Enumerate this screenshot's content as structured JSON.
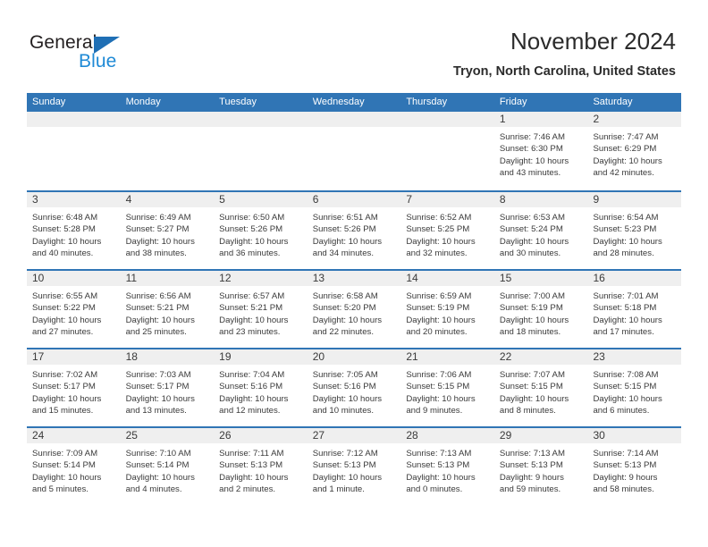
{
  "brand": {
    "name_top": "General",
    "name_bottom": "Blue",
    "triangle_color": "#1f6fb5",
    "blue_text_color": "#1f8ad6"
  },
  "header": {
    "title": "November 2024",
    "subtitle": "Tryon, North Carolina, United States",
    "accent_color": "#3075b5",
    "daynum_band_color": "#efefef"
  },
  "weekdays": [
    "Sunday",
    "Monday",
    "Tuesday",
    "Wednesday",
    "Thursday",
    "Friday",
    "Saturday"
  ],
  "labels": {
    "sunrise": "Sunrise:",
    "sunset": "Sunset:",
    "daylight": "Daylight:"
  },
  "weeks": [
    [
      {
        "day": "",
        "empty": true
      },
      {
        "day": "",
        "empty": true
      },
      {
        "day": "",
        "empty": true
      },
      {
        "day": "",
        "empty": true
      },
      {
        "day": "",
        "empty": true
      },
      {
        "day": "1",
        "sunrise": "Sunrise: 7:46 AM",
        "sunset": "Sunset: 6:30 PM",
        "daylight_1": "Daylight: 10 hours",
        "daylight_2": "and 43 minutes."
      },
      {
        "day": "2",
        "sunrise": "Sunrise: 7:47 AM",
        "sunset": "Sunset: 6:29 PM",
        "daylight_1": "Daylight: 10 hours",
        "daylight_2": "and 42 minutes."
      }
    ],
    [
      {
        "day": "3",
        "sunrise": "Sunrise: 6:48 AM",
        "sunset": "Sunset: 5:28 PM",
        "daylight_1": "Daylight: 10 hours",
        "daylight_2": "and 40 minutes."
      },
      {
        "day": "4",
        "sunrise": "Sunrise: 6:49 AM",
        "sunset": "Sunset: 5:27 PM",
        "daylight_1": "Daylight: 10 hours",
        "daylight_2": "and 38 minutes."
      },
      {
        "day": "5",
        "sunrise": "Sunrise: 6:50 AM",
        "sunset": "Sunset: 5:26 PM",
        "daylight_1": "Daylight: 10 hours",
        "daylight_2": "and 36 minutes."
      },
      {
        "day": "6",
        "sunrise": "Sunrise: 6:51 AM",
        "sunset": "Sunset: 5:26 PM",
        "daylight_1": "Daylight: 10 hours",
        "daylight_2": "and 34 minutes."
      },
      {
        "day": "7",
        "sunrise": "Sunrise: 6:52 AM",
        "sunset": "Sunset: 5:25 PM",
        "daylight_1": "Daylight: 10 hours",
        "daylight_2": "and 32 minutes."
      },
      {
        "day": "8",
        "sunrise": "Sunrise: 6:53 AM",
        "sunset": "Sunset: 5:24 PM",
        "daylight_1": "Daylight: 10 hours",
        "daylight_2": "and 30 minutes."
      },
      {
        "day": "9",
        "sunrise": "Sunrise: 6:54 AM",
        "sunset": "Sunset: 5:23 PM",
        "daylight_1": "Daylight: 10 hours",
        "daylight_2": "and 28 minutes."
      }
    ],
    [
      {
        "day": "10",
        "sunrise": "Sunrise: 6:55 AM",
        "sunset": "Sunset: 5:22 PM",
        "daylight_1": "Daylight: 10 hours",
        "daylight_2": "and 27 minutes."
      },
      {
        "day": "11",
        "sunrise": "Sunrise: 6:56 AM",
        "sunset": "Sunset: 5:21 PM",
        "daylight_1": "Daylight: 10 hours",
        "daylight_2": "and 25 minutes."
      },
      {
        "day": "12",
        "sunrise": "Sunrise: 6:57 AM",
        "sunset": "Sunset: 5:21 PM",
        "daylight_1": "Daylight: 10 hours",
        "daylight_2": "and 23 minutes."
      },
      {
        "day": "13",
        "sunrise": "Sunrise: 6:58 AM",
        "sunset": "Sunset: 5:20 PM",
        "daylight_1": "Daylight: 10 hours",
        "daylight_2": "and 22 minutes."
      },
      {
        "day": "14",
        "sunrise": "Sunrise: 6:59 AM",
        "sunset": "Sunset: 5:19 PM",
        "daylight_1": "Daylight: 10 hours",
        "daylight_2": "and 20 minutes."
      },
      {
        "day": "15",
        "sunrise": "Sunrise: 7:00 AM",
        "sunset": "Sunset: 5:19 PM",
        "daylight_1": "Daylight: 10 hours",
        "daylight_2": "and 18 minutes."
      },
      {
        "day": "16",
        "sunrise": "Sunrise: 7:01 AM",
        "sunset": "Sunset: 5:18 PM",
        "daylight_1": "Daylight: 10 hours",
        "daylight_2": "and 17 minutes."
      }
    ],
    [
      {
        "day": "17",
        "sunrise": "Sunrise: 7:02 AM",
        "sunset": "Sunset: 5:17 PM",
        "daylight_1": "Daylight: 10 hours",
        "daylight_2": "and 15 minutes."
      },
      {
        "day": "18",
        "sunrise": "Sunrise: 7:03 AM",
        "sunset": "Sunset: 5:17 PM",
        "daylight_1": "Daylight: 10 hours",
        "daylight_2": "and 13 minutes."
      },
      {
        "day": "19",
        "sunrise": "Sunrise: 7:04 AM",
        "sunset": "Sunset: 5:16 PM",
        "daylight_1": "Daylight: 10 hours",
        "daylight_2": "and 12 minutes."
      },
      {
        "day": "20",
        "sunrise": "Sunrise: 7:05 AM",
        "sunset": "Sunset: 5:16 PM",
        "daylight_1": "Daylight: 10 hours",
        "daylight_2": "and 10 minutes."
      },
      {
        "day": "21",
        "sunrise": "Sunrise: 7:06 AM",
        "sunset": "Sunset: 5:15 PM",
        "daylight_1": "Daylight: 10 hours",
        "daylight_2": "and 9 minutes."
      },
      {
        "day": "22",
        "sunrise": "Sunrise: 7:07 AM",
        "sunset": "Sunset: 5:15 PM",
        "daylight_1": "Daylight: 10 hours",
        "daylight_2": "and 8 minutes."
      },
      {
        "day": "23",
        "sunrise": "Sunrise: 7:08 AM",
        "sunset": "Sunset: 5:15 PM",
        "daylight_1": "Daylight: 10 hours",
        "daylight_2": "and 6 minutes."
      }
    ],
    [
      {
        "day": "24",
        "sunrise": "Sunrise: 7:09 AM",
        "sunset": "Sunset: 5:14 PM",
        "daylight_1": "Daylight: 10 hours",
        "daylight_2": "and 5 minutes."
      },
      {
        "day": "25",
        "sunrise": "Sunrise: 7:10 AM",
        "sunset": "Sunset: 5:14 PM",
        "daylight_1": "Daylight: 10 hours",
        "daylight_2": "and 4 minutes."
      },
      {
        "day": "26",
        "sunrise": "Sunrise: 7:11 AM",
        "sunset": "Sunset: 5:13 PM",
        "daylight_1": "Daylight: 10 hours",
        "daylight_2": "and 2 minutes."
      },
      {
        "day": "27",
        "sunrise": "Sunrise: 7:12 AM",
        "sunset": "Sunset: 5:13 PM",
        "daylight_1": "Daylight: 10 hours",
        "daylight_2": "and 1 minute."
      },
      {
        "day": "28",
        "sunrise": "Sunrise: 7:13 AM",
        "sunset": "Sunset: 5:13 PM",
        "daylight_1": "Daylight: 10 hours",
        "daylight_2": "and 0 minutes."
      },
      {
        "day": "29",
        "sunrise": "Sunrise: 7:13 AM",
        "sunset": "Sunset: 5:13 PM",
        "daylight_1": "Daylight: 9 hours",
        "daylight_2": "and 59 minutes."
      },
      {
        "day": "30",
        "sunrise": "Sunrise: 7:14 AM",
        "sunset": "Sunset: 5:13 PM",
        "daylight_1": "Daylight: 9 hours",
        "daylight_2": "and 58 minutes."
      }
    ]
  ]
}
